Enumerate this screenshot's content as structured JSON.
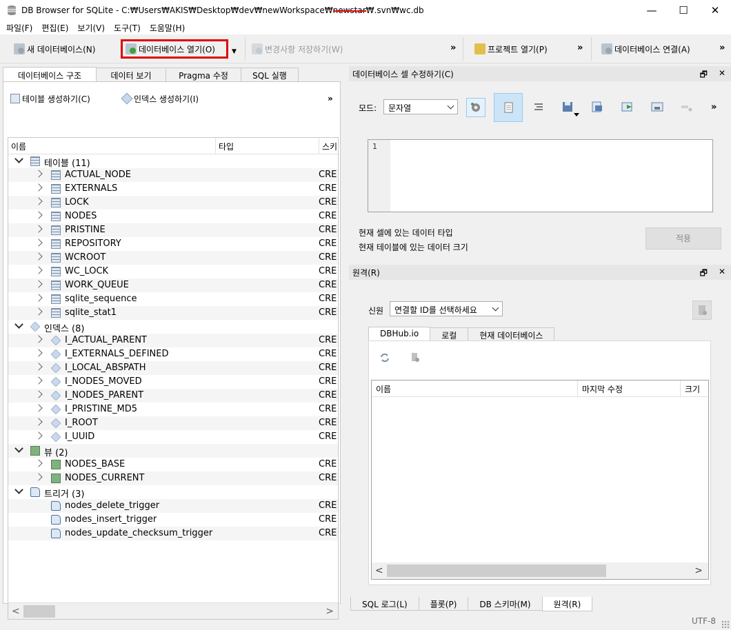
{
  "window": {
    "title_prefix": "DB Browser for SQLite - C:₩Users₩AKIS₩Desktop₩dev₩newWorkspace₩",
    "title_redacted": "newstar",
    "title_suffix": "₩.svn₩wc.db",
    "controls": {
      "minimize": "—",
      "maximize": "☐",
      "close": "✕"
    }
  },
  "menu": [
    "파일(F)",
    "편집(E)",
    "보기(V)",
    "도구(T)",
    "도움말(H)"
  ],
  "toolbar": {
    "new_db": "새 데이터베이스(N)",
    "open_db": "데이터베이스 열기(O)",
    "write_changes": "변경사항 저장하기(W)",
    "open_project": "프로젝트 열기(P)",
    "attach_db": "데이터베이스 연결(A)",
    "more": "»",
    "highlight_color": "#e00000"
  },
  "left_tabs": [
    "데이터베이스 구조",
    "데이터 보기",
    "Pragma 수정",
    "SQL 실행"
  ],
  "structure": {
    "create_table": "테이블 생성하기(C)",
    "create_index": "인덱스 생성하기(I)",
    "more": "»",
    "columns": {
      "name": "이름",
      "type": "타입",
      "schema": "스키"
    },
    "groups": [
      {
        "label": "테이블 (11)",
        "icon": "table-icon",
        "items": [
          "ACTUAL_NODE",
          "EXTERNALS",
          "LOCK",
          "NODES",
          "PRISTINE",
          "REPOSITORY",
          "WCROOT",
          "WC_LOCK",
          "WORK_QUEUE",
          "sqlite_sequence",
          "sqlite_stat1"
        ]
      },
      {
        "label": "인덱스 (8)",
        "icon": "index-icon",
        "items": [
          "I_ACTUAL_PARENT",
          "I_EXTERNALS_DEFINED",
          "I_LOCAL_ABSPATH",
          "I_NODES_MOVED",
          "I_NODES_PARENT",
          "I_PRISTINE_MD5",
          "I_ROOT",
          "I_UUID"
        ]
      },
      {
        "label": "뷰 (2)",
        "icon": "view-icon",
        "items": [
          "NODES_BASE",
          "NODES_CURRENT"
        ]
      },
      {
        "label": "트리거 (3)",
        "icon": "trigger-icon",
        "items": [
          "nodes_delete_trigger",
          "nodes_insert_trigger",
          "nodes_update_checksum_trigger"
        ]
      }
    ],
    "schema_prefix": "CRE"
  },
  "edit_cell": {
    "title": "데이터베이스 셀 수정하기(C)",
    "mode_label": "모드:",
    "mode_value": "문자열",
    "line_number": "1",
    "data_type_label": "현재 셀에 있는 데이터 타입",
    "data_size_label": "현재 테이블에 있는 데이터 크기",
    "apply": "적용",
    "more": "»"
  },
  "remote": {
    "title": "원격(R)",
    "identity_label": "신원",
    "identity_value": "연결할 ID를 선택하세요",
    "tabs": [
      "DBHub.io",
      "로컬",
      "현재 데이터베이스"
    ],
    "columns": {
      "name": "이름",
      "modified": "마지막 수정",
      "size": "크기"
    }
  },
  "dock_buttons": {
    "float": "🗗",
    "close": "✕"
  },
  "bottom_tabs": [
    "SQL 로그(L)",
    "플롯(P)",
    "DB 스키마(M)",
    "원격(R)"
  ],
  "status": {
    "encoding": "UTF-8"
  }
}
